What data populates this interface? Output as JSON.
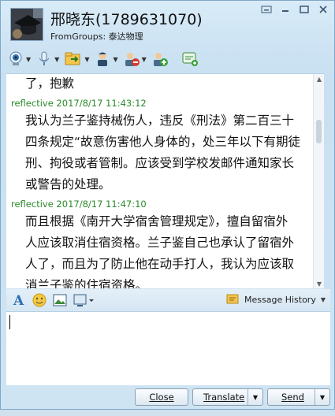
{
  "header": {
    "contact_name": "邢晓东(1789631070)",
    "group": "FromGroups: 泰达物理"
  },
  "icons": {
    "avatar": "avatar-image",
    "video": "webcam-icon",
    "voice": "microphone-icon",
    "file": "folder-transfer-icon",
    "remote": "remote-assist-icon",
    "block": "remove-contact-icon",
    "add": "add-contact-icon",
    "app": "app-icon"
  },
  "messages": [
    {
      "type": "text",
      "lines": [
        "了，抱歉"
      ]
    },
    {
      "type": "head",
      "sender": "reflective",
      "time": "2017/8/17 11:43:12"
    },
    {
      "type": "text",
      "lines": [
        "我认为兰子鉴持械伤人，违反《刑法》第二百三十",
        "四条规定“故意伤害他人身体的，处三年以下有期徒",
        "刑、拘役或者管制。应该受到学校发邮件通知家长",
        "或警告的处理。"
      ]
    },
    {
      "type": "head",
      "sender": "reflective",
      "time": "2017/8/17 11:47:10"
    },
    {
      "type": "text",
      "lines": [
        "而且根据《南开大学宿舍管理规定》，擅自留宿外",
        "人应该取消住宿资格。兰子鉴自己也承认了留宿外",
        "人了，而且为了防止他在动手打人，我认为应该取",
        "消兰子鉴的住宿资格。"
      ]
    }
  ],
  "format_bar": {
    "history_label": "Message History"
  },
  "buttons": {
    "close": "Close",
    "translate": "Translate",
    "send": "Send"
  },
  "colors": {
    "sender": "#2a8a2a",
    "accent": "#7fa7c7"
  }
}
